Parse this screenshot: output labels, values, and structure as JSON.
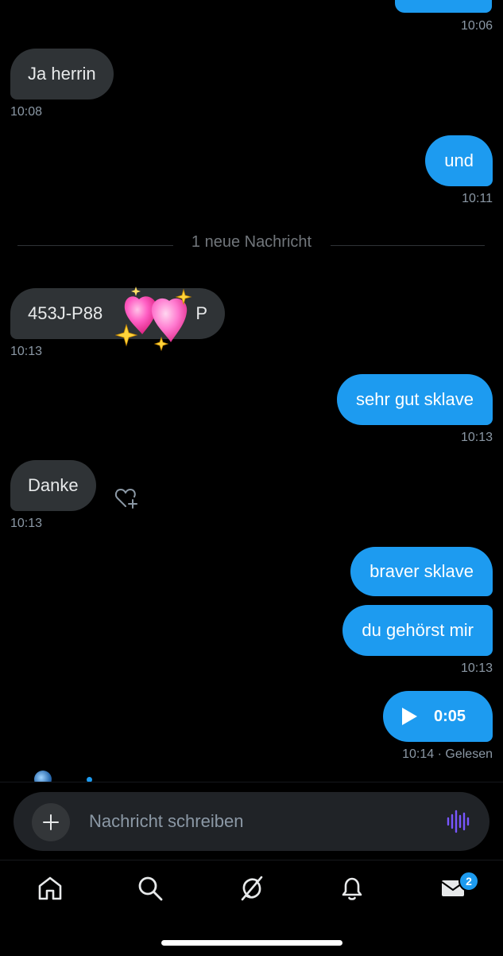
{
  "colors": {
    "background": "#000000",
    "incoming_bubble": "#2f3336",
    "outgoing_bubble": "#1d9bf0",
    "timestamp": "#8b98a5",
    "badge": "#1d9bf0",
    "voice_icon": "#7856ff"
  },
  "conversation": {
    "top_timestamp": "10:06",
    "divider_text": "1 neue Nachricht",
    "messages": [
      {
        "direction": "incoming",
        "text": "Ja herrin",
        "time": "10:08"
      },
      {
        "direction": "outgoing",
        "text": "und",
        "time": "10:11"
      },
      {
        "direction": "incoming",
        "text_visible_start": "453J-P88",
        "text_visible_end": "P",
        "time": "10:13",
        "reaction": "sparkling-heart-emoji"
      },
      {
        "direction": "outgoing",
        "text": "sehr gut sklave",
        "time": "10:13"
      },
      {
        "direction": "incoming",
        "text": "Danke",
        "time": "10:13",
        "action": "add-reaction-icon"
      },
      {
        "direction": "outgoing",
        "text": "braver sklave"
      },
      {
        "direction": "outgoing",
        "text": "du gehörst mir",
        "time": "10:13"
      },
      {
        "direction": "outgoing",
        "type": "voice",
        "duration": "0:05",
        "time": "10:14",
        "status": "· Gelesen"
      }
    ]
  },
  "composer": {
    "placeholder": "Nachricht schreiben",
    "value": ""
  },
  "bottom_nav": {
    "items": [
      "home-icon",
      "search-icon",
      "grok-icon",
      "bell-icon",
      "mail-icon"
    ],
    "mail_badge": "2"
  }
}
